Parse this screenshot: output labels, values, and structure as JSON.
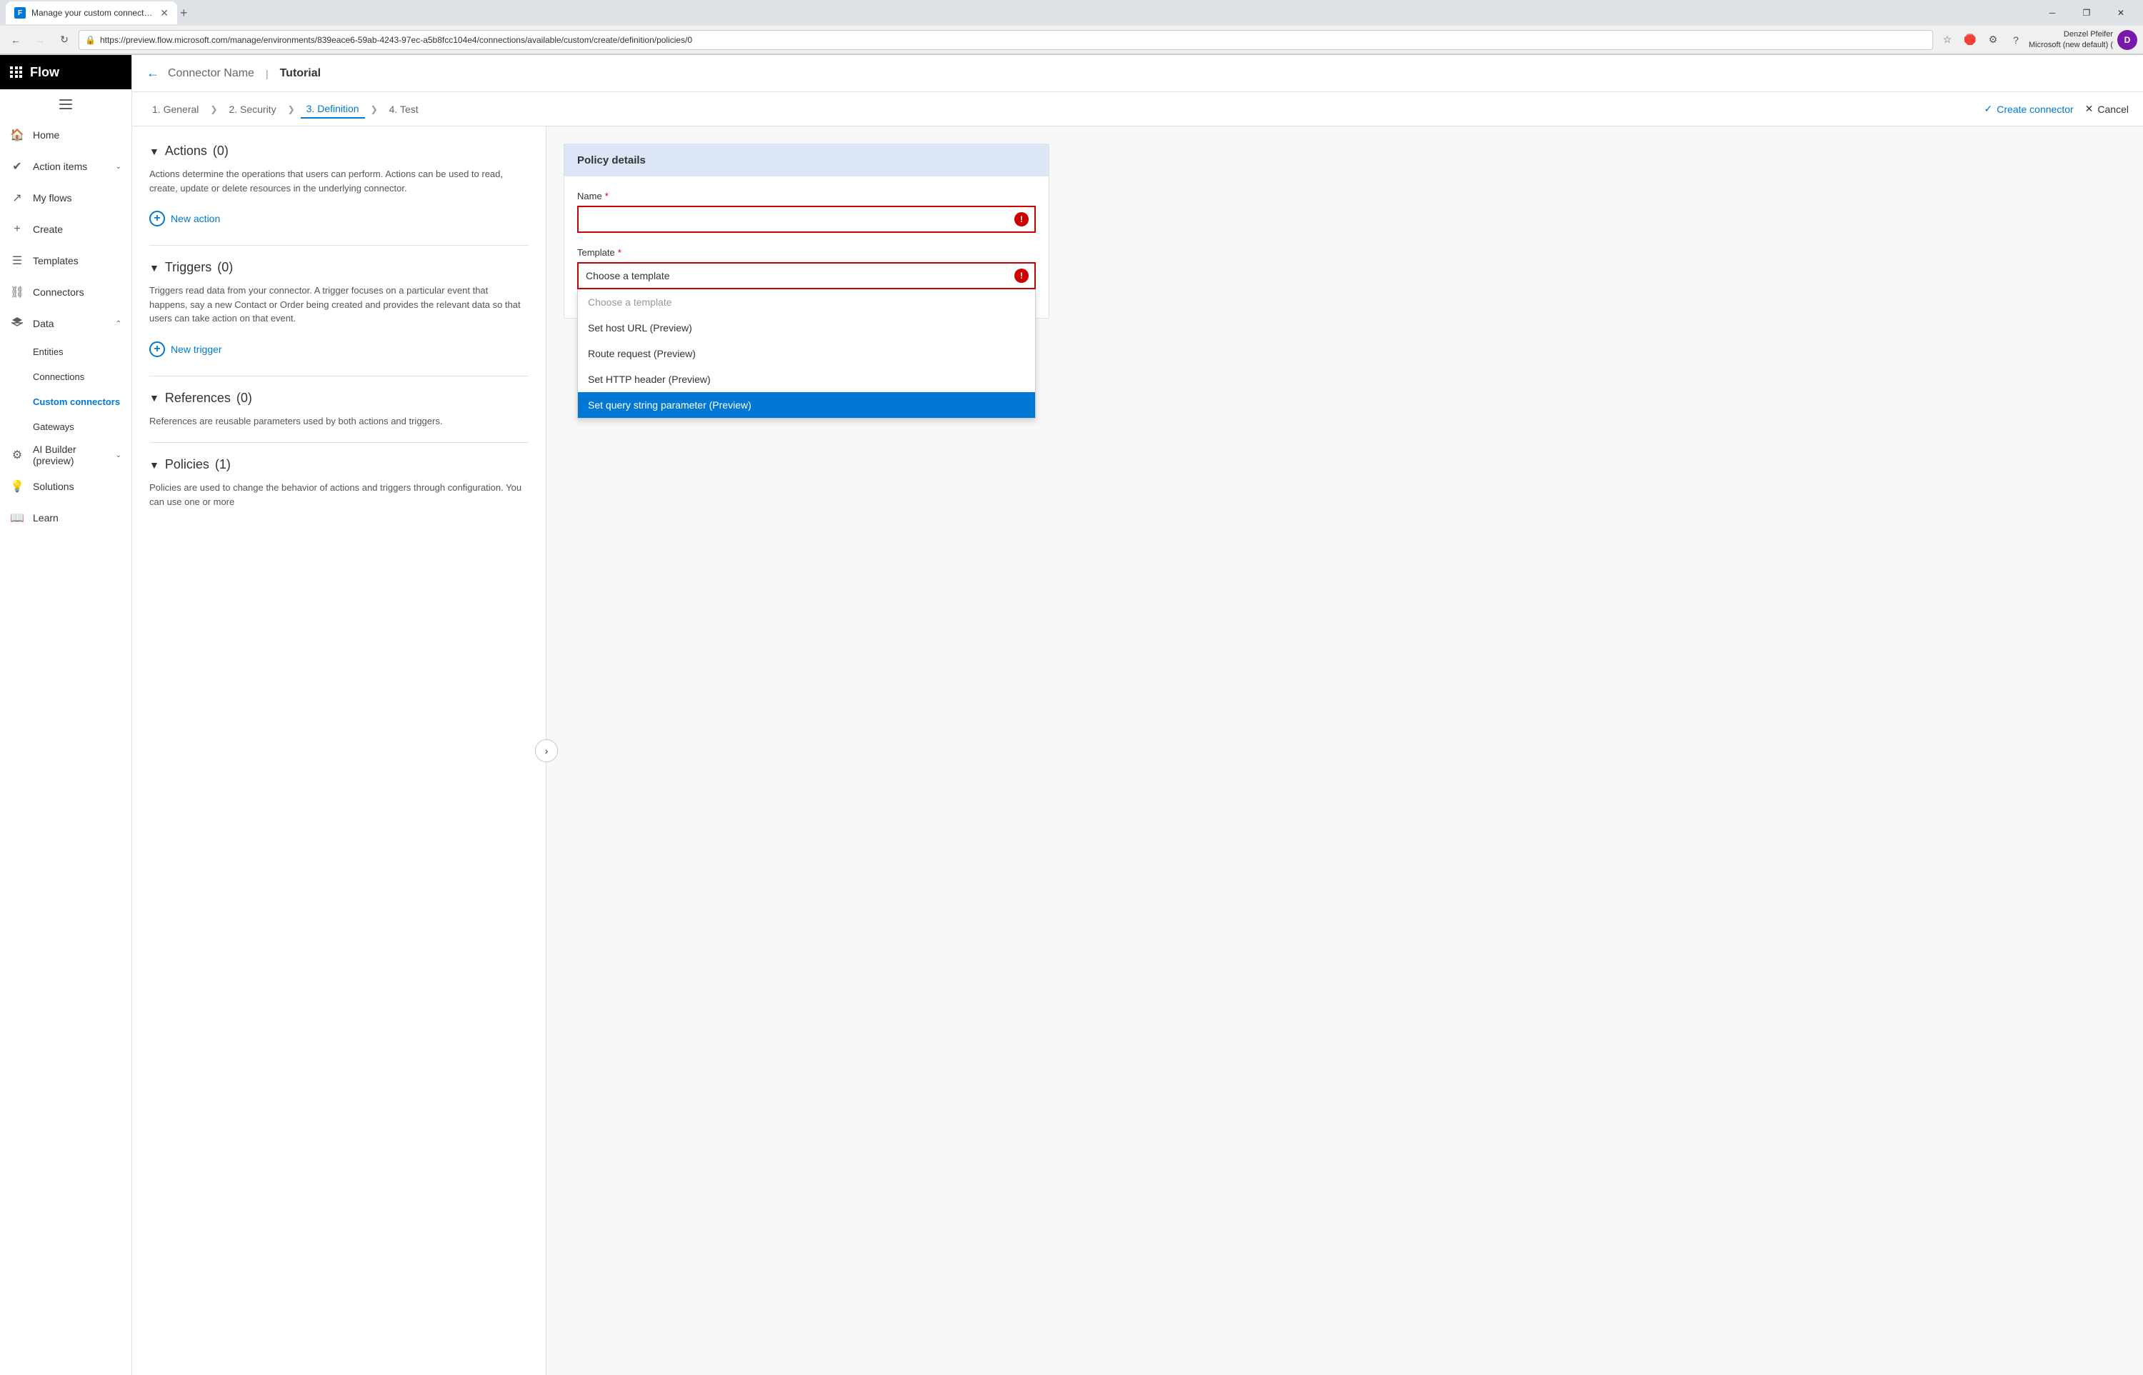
{
  "browser": {
    "tab_title": "Manage your custom connectors",
    "tab_favicon": "F",
    "url": "https://preview.flow.microsoft.com/manage/environments/839eace6-59ab-4243-97ec-a5b8fcc104e4/connections/available/custom/create/definition/policies/0",
    "win_minimize": "─",
    "win_restore": "❐",
    "win_close": "✕"
  },
  "header_app": {
    "app_name": "Flow",
    "profile_name": "Denzel Pfeifer",
    "profile_org": "Microsoft (new default) (",
    "profile_initials": "D"
  },
  "sidebar": {
    "items": [
      {
        "id": "home",
        "label": "Home",
        "icon": "🏠"
      },
      {
        "id": "action-items",
        "label": "Action items",
        "icon": "✓"
      },
      {
        "id": "my-flows",
        "label": "My flows",
        "icon": "⤷"
      },
      {
        "id": "create",
        "label": "Create",
        "icon": "+"
      },
      {
        "id": "templates",
        "label": "Templates",
        "icon": "☰"
      },
      {
        "id": "connectors",
        "label": "Connectors",
        "icon": "⛓"
      },
      {
        "id": "data",
        "label": "Data",
        "icon": "⬡",
        "expanded": true
      },
      {
        "id": "entities",
        "label": "Entities",
        "sub": true
      },
      {
        "id": "connections",
        "label": "Connections",
        "sub": true
      },
      {
        "id": "custom-connectors",
        "label": "Custom connectors",
        "sub": true,
        "active": true
      },
      {
        "id": "gateways",
        "label": "Gateways",
        "sub": true
      },
      {
        "id": "ai-builder",
        "label": "AI Builder (preview)",
        "icon": "⚙"
      },
      {
        "id": "solutions",
        "label": "Solutions",
        "icon": "💡"
      },
      {
        "id": "learn",
        "label": "Learn",
        "icon": "📖"
      }
    ]
  },
  "topbar": {
    "connector_name": "Connector Name",
    "tutorial": "Tutorial"
  },
  "wizard": {
    "steps": [
      {
        "id": "general",
        "label": "1. General"
      },
      {
        "id": "security",
        "label": "2. Security"
      },
      {
        "id": "definition",
        "label": "3. Definition",
        "active": true
      },
      {
        "id": "test",
        "label": "4. Test"
      }
    ],
    "create_label": "Create connector",
    "cancel_label": "Cancel"
  },
  "left_panel": {
    "actions_section": {
      "title": "Actions",
      "count": "(0)",
      "description": "Actions determine the operations that users can perform. Actions can be used to read, create, update or delete resources in the underlying connector."
    },
    "new_action_label": "New action",
    "triggers_section": {
      "title": "Triggers",
      "count": "(0)",
      "description": "Triggers read data from your connector. A trigger focuses on a particular event that happens, say a new Contact or Order being created and provides the relevant data so that users can take action on that event."
    },
    "new_trigger_label": "New trigger",
    "references_section": {
      "title": "References",
      "count": "(0)",
      "description": "References are reusable parameters used by both actions and triggers."
    },
    "policies_section": {
      "title": "Policies",
      "count": "(1)",
      "description": "Policies are used to change the behavior of actions and triggers through configuration. You can use one or more"
    }
  },
  "policy_details": {
    "panel_title": "Policy details",
    "name_label": "Name",
    "name_required": "*",
    "name_value": "",
    "template_label": "Template",
    "template_required": "*",
    "template_placeholder": "Choose a template",
    "dropdown_options": [
      {
        "id": "placeholder",
        "label": "Choose a template",
        "type": "placeholder"
      },
      {
        "id": "set-host-url",
        "label": "Set host URL (Preview)",
        "type": "option"
      },
      {
        "id": "route-request",
        "label": "Route request (Preview)",
        "type": "option"
      },
      {
        "id": "set-http-header",
        "label": "Set HTTP header (Preview)",
        "type": "option"
      },
      {
        "id": "set-query-string",
        "label": "Set query string parameter (Preview)",
        "type": "selected"
      }
    ]
  }
}
